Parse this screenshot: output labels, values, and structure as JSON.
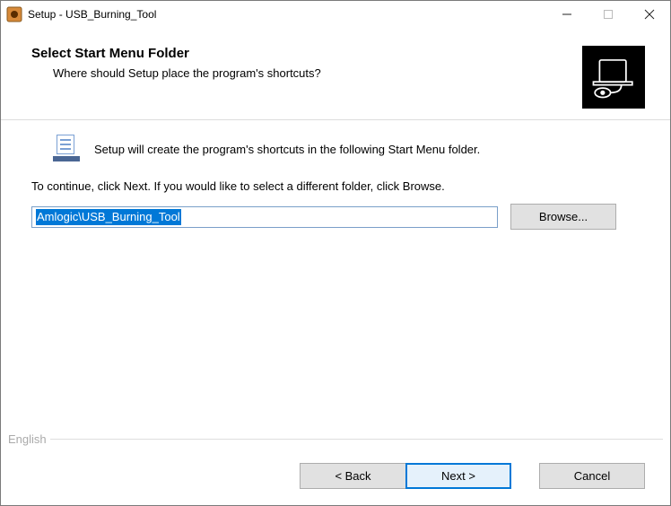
{
  "window": {
    "title": "Setup - USB_Burning_Tool"
  },
  "header": {
    "heading": "Select Start Menu Folder",
    "subtitle": "Where should Setup place the program's shortcuts?"
  },
  "content": {
    "intro": "Setup will create the program's shortcuts in the following Start Menu folder.",
    "continue": "To continue, click Next. If you would like to select a different folder, click Browse.",
    "path_value": "Amlogic\\USB_Burning_Tool",
    "browse_label": "Browse..."
  },
  "language": {
    "label": "English"
  },
  "footer": {
    "back_label": "< Back",
    "next_label": "Next >",
    "cancel_label": "Cancel"
  }
}
